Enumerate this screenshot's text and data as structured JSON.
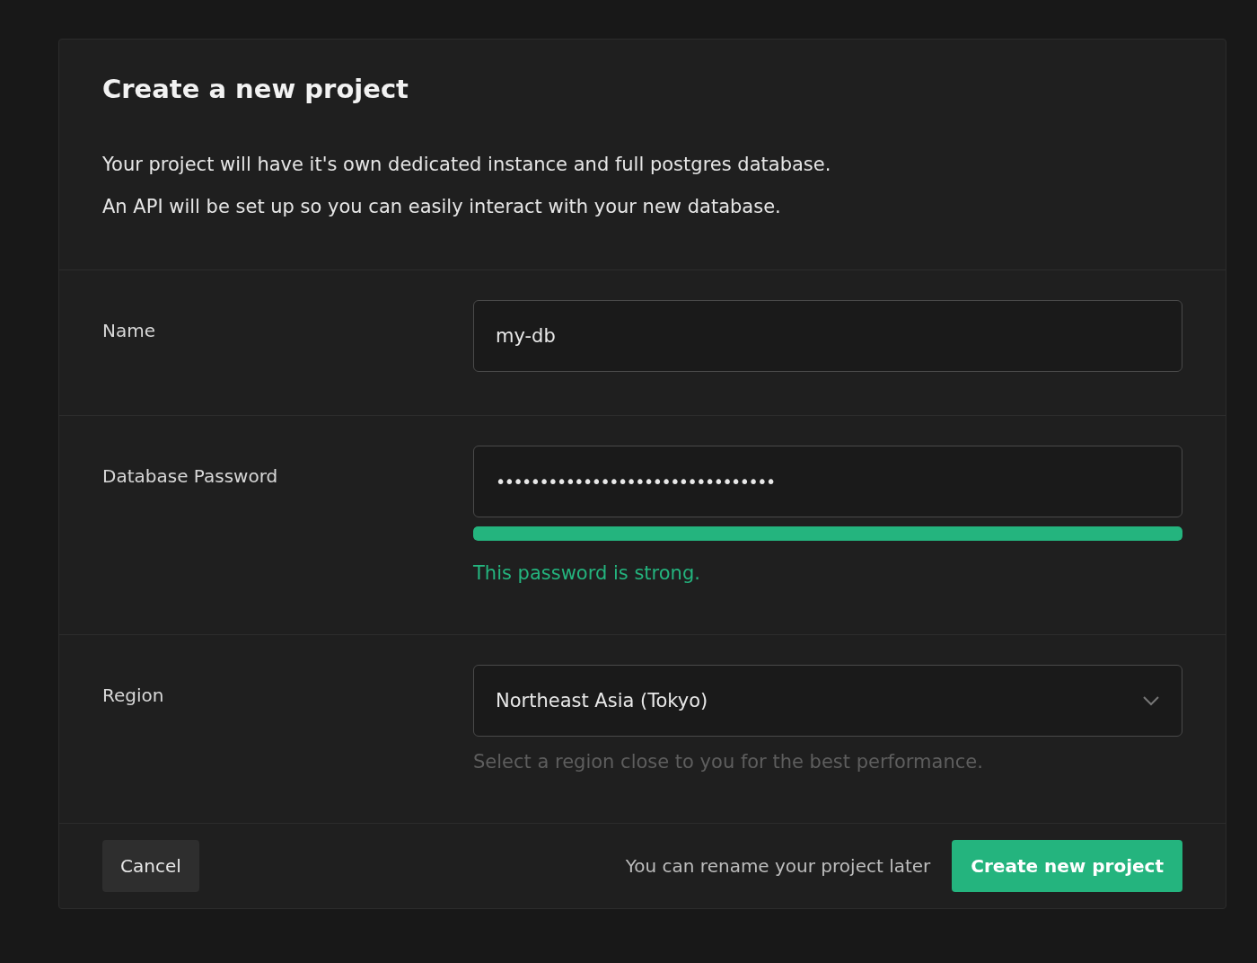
{
  "dialog": {
    "title": "Create a new project",
    "description": [
      "Your project will have it's own dedicated instance and full postgres database.",
      "An API will be set up so you can easily interact with your new database."
    ]
  },
  "fields": [
    {
      "kind": "text",
      "label": "Name",
      "value": "my-db"
    },
    {
      "kind": "password",
      "label": "Database Password",
      "value": "••••••••••••••••••••••••••••••••",
      "strength": {
        "level": 1,
        "message": "This password is strong."
      }
    },
    {
      "kind": "select",
      "label": "Region",
      "value": "Northeast Asia (Tokyo)",
      "hint": "Select a region close to you for the best performance."
    }
  ],
  "footer": {
    "cancel": "Cancel",
    "note": "You can rename your project later",
    "submit": "Create new project"
  }
}
